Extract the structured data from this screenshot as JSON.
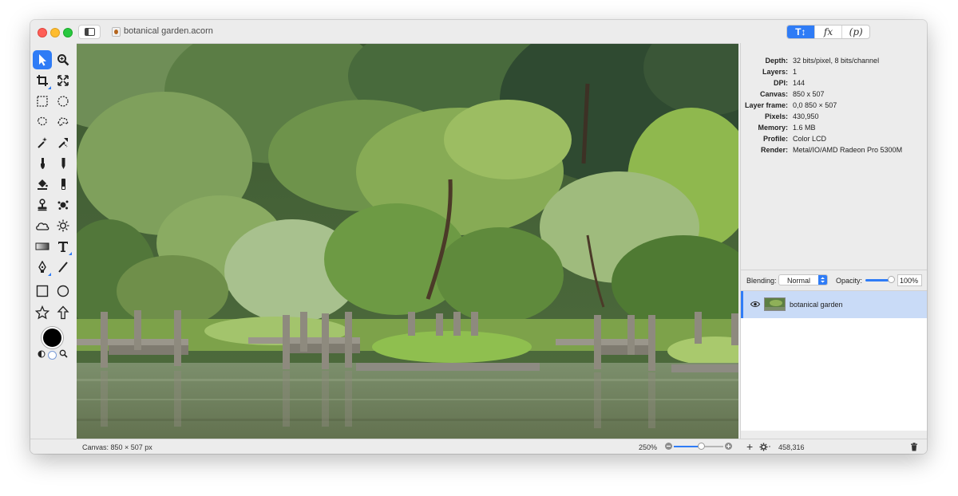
{
  "window": {
    "document_title": "botanical garden.acorn"
  },
  "inspector_tabs": [
    {
      "label": "T↕",
      "icon": "tools-inspector-icon",
      "active": true
    },
    {
      "label": "fx",
      "icon": "filters-icon",
      "active": false
    },
    {
      "label": "(p)",
      "icon": "plugins-icon",
      "active": false
    }
  ],
  "info": [
    {
      "label": "Depth:",
      "value": "32 bits/pixel, 8 bits/channel"
    },
    {
      "label": "Layers:",
      "value": "1"
    },
    {
      "label": "DPI:",
      "value": "144"
    },
    {
      "label": "Canvas:",
      "value": "850 x 507"
    },
    {
      "label": "Layer frame:",
      "value": "0,0 850 × 507"
    },
    {
      "label": "Pixels:",
      "value": "430,950"
    },
    {
      "label": "Memory:",
      "value": "1.6 MB"
    },
    {
      "label": "Profile:",
      "value": "Color LCD"
    },
    {
      "label": "Render:",
      "value": "Metal/IO/AMD Radeon Pro 5300M"
    }
  ],
  "layer_controls": {
    "blending_label": "Blending:",
    "blending_value": "Normal",
    "opacity_label": "Opacity:",
    "opacity_value": "100%"
  },
  "layers": [
    {
      "name": "botanical garden",
      "visible": true,
      "selected": true
    }
  ],
  "status": {
    "canvas_size": "Canvas: 850 × 507 px",
    "zoom": "250%",
    "coordinates": "458,316"
  },
  "colors": {
    "accent": "#2f7cf6",
    "foreground_color": "#000000",
    "background_color": "#ffffff"
  },
  "tools": [
    "move-tool-icon",
    "zoom-tool-icon",
    "crop-tool-icon",
    "transform-tool-icon",
    "rect-select-icon",
    "ellipse-select-icon",
    "lasso-icon",
    "polygon-lasso-icon",
    "magic-wand-icon",
    "color-select-icon",
    "brush-icon",
    "pencil-icon",
    "paint-bucket-icon",
    "eraser-icon",
    "clone-stamp-icon",
    "smudge-icon",
    "cloud-icon",
    "sun-icon",
    "gradient-icon",
    "text-icon",
    "pen-icon",
    "line-icon",
    "rectangle-icon",
    "oval-icon",
    "star-icon",
    "arrow-icon"
  ]
}
